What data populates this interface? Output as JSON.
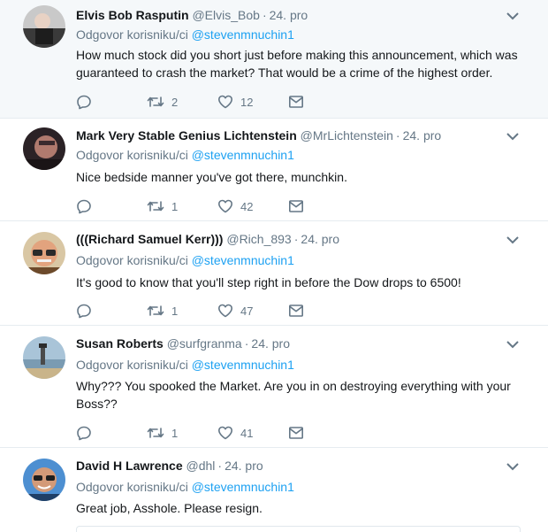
{
  "reply_prefix": "Odgovor korisniku/ci",
  "tweets": [
    {
      "name": "Elvis Bob Rasputin",
      "handle": "@Elvis_Bob",
      "time": "24. pro",
      "reply_to": "@stevenmnuchin1",
      "text": "How much stock did you short just before making this announcement, which was guaranteed to crash the market? That would be a crime of the highest order.",
      "retweets": "2",
      "likes": "12"
    },
    {
      "name": "Mark Very Stable Genius Lichtenstein",
      "handle": "@MrLichtenstein",
      "time": "24. pro",
      "reply_to": "@stevenmnuchin1",
      "text": "Nice bedside manner you've got there, munchkin.",
      "retweets": "1",
      "likes": "42"
    },
    {
      "name": "(((Richard Samuel Kerr)))",
      "handle": "@Rich_893",
      "time": "24. pro",
      "reply_to": "@stevenmnuchin1",
      "text": "It's good to know that you'll step right in before the Dow drops to 6500!",
      "retweets": "1",
      "likes": "47"
    },
    {
      "name": "Susan Roberts",
      "handle": "@surfgranma",
      "time": "24. pro",
      "reply_to": "@stevenmnuchin1",
      "text": "Why??? You spooked the Market. Are you in on destroying everything with your Boss??",
      "retweets": "1",
      "likes": "41"
    },
    {
      "name": "David H Lawrence",
      "handle": "@dhl",
      "time": "24. pro",
      "reply_to": "@stevenmnuchin1",
      "text": "Great job, Asshole. Please resign."
    }
  ]
}
